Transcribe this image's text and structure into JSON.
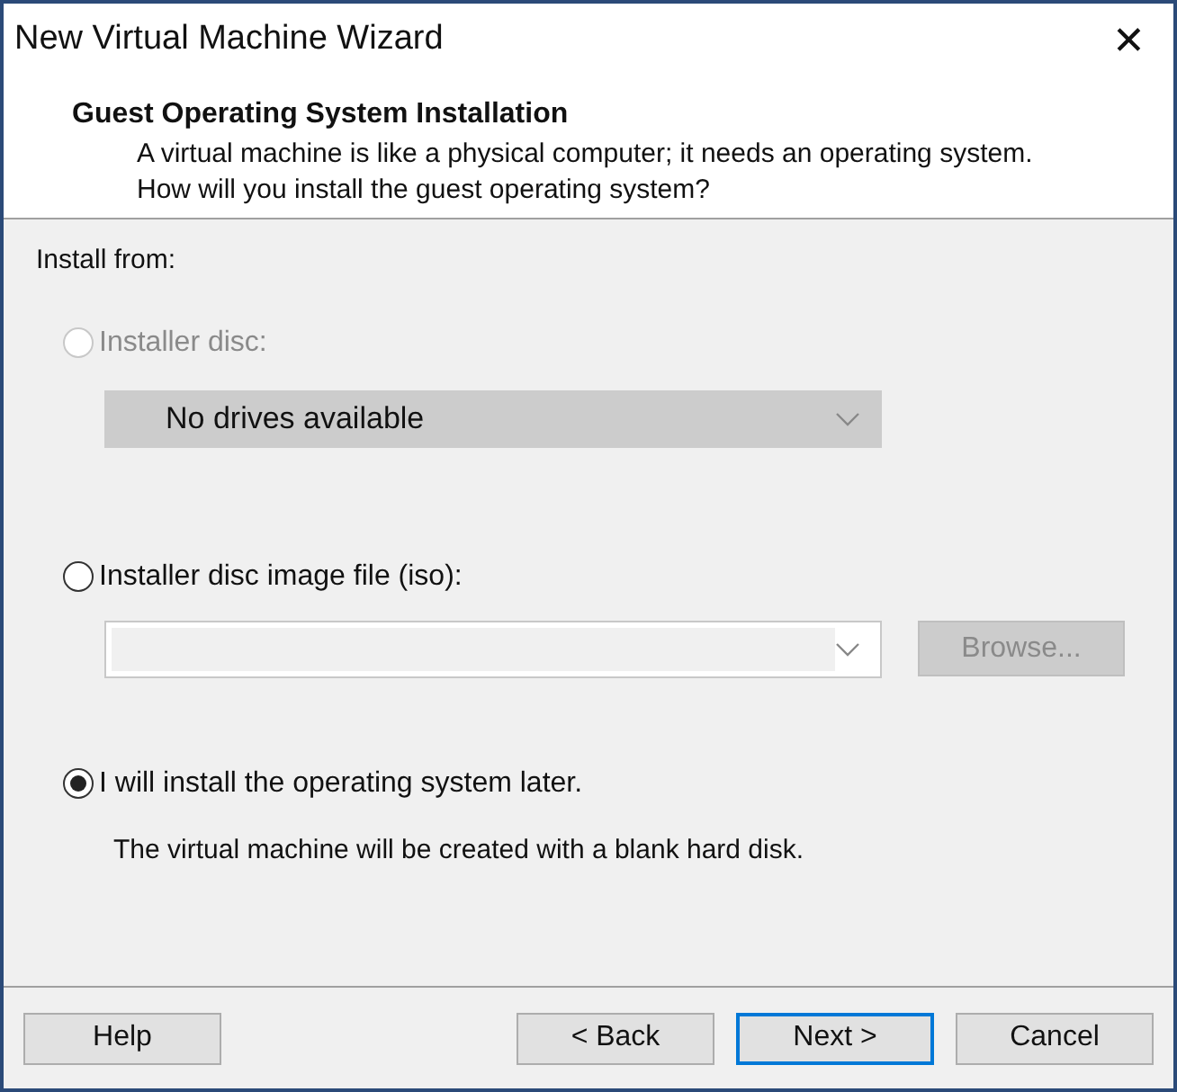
{
  "window": {
    "title": "New Virtual Machine Wizard",
    "close": "✕"
  },
  "header": {
    "title": "Guest Operating System Installation",
    "description": "A virtual machine is like a physical computer; it needs an operating system. How will you install the guest operating system?"
  },
  "install_from": {
    "label": "Install from:"
  },
  "options": [
    {
      "kind": "dropdown",
      "label": "Installer disc:",
      "selected": false,
      "disabled": true,
      "dropdown": {
        "value": "No drives available",
        "disabled": true
      }
    },
    {
      "kind": "file",
      "label": "Installer disc image file (iso):",
      "selected": false,
      "disabled": false,
      "dropdown": {
        "disabled": false
      },
      "browse": {
        "label": "Browse...",
        "disabled": true
      }
    },
    {
      "kind": "note",
      "label": "I will install the operating system later.",
      "selected": true,
      "disabled": false,
      "note": "The virtual machine will be created with a blank hard disk."
    }
  ],
  "buttons": [
    {
      "label": "Help",
      "default": false
    },
    {
      "label": "< Back",
      "default": false
    },
    {
      "label": "Next >",
      "default": true
    },
    {
      "label": "Cancel",
      "default": false
    }
  ]
}
